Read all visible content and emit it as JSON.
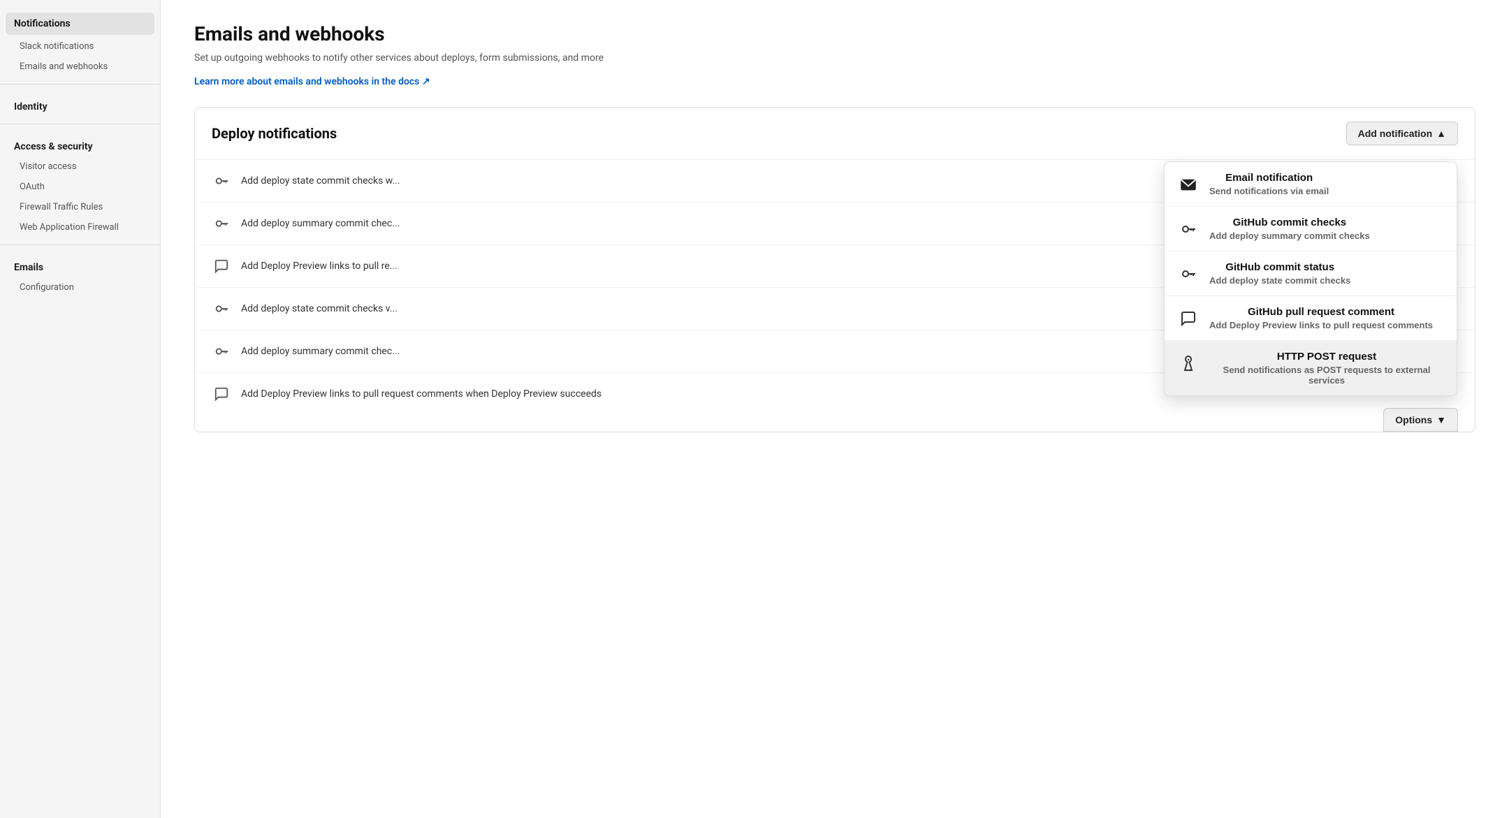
{
  "sidebar": {
    "sections": [
      {
        "label": "Notifications",
        "active": true,
        "items": [
          {
            "label": "Slack notifications",
            "child": true
          },
          {
            "label": "Emails and webhooks",
            "child": true
          }
        ]
      },
      {
        "label": "Identity",
        "active": false,
        "items": []
      },
      {
        "label": "Access & security",
        "active": false,
        "items": [
          {
            "label": "Visitor access",
            "child": true
          },
          {
            "label": "OAuth",
            "child": true
          },
          {
            "label": "Firewall Traffic Rules",
            "child": true
          },
          {
            "label": "Web Application Firewall",
            "child": true
          }
        ]
      },
      {
        "label": "Emails",
        "active": false,
        "items": [
          {
            "label": "Configuration",
            "child": true
          }
        ]
      }
    ]
  },
  "main": {
    "page_title": "Emails and webhooks",
    "page_subtitle": "Set up outgoing webhooks to notify other services about deploys, form submissions, and more",
    "docs_link_text": "Learn more about emails and webhooks in the docs ↗",
    "section_title": "Deploy notifications",
    "add_button_label": "Add notification",
    "add_button_chevron": "▲",
    "notification_items": [
      {
        "icon": "key",
        "text": "Add deploy state commit checks w..."
      },
      {
        "icon": "key",
        "text": "Add deploy summary commit chec..."
      },
      {
        "icon": "chat",
        "text": "Add Deploy Preview links to pull re..."
      },
      {
        "icon": "key",
        "text": "Add deploy state commit checks v..."
      },
      {
        "icon": "key",
        "text": "Add deploy summary commit chec..."
      },
      {
        "icon": "chat",
        "text": "Add Deploy Preview links to pull request comments when Deploy Preview succeeds"
      }
    ],
    "dropdown": {
      "items": [
        {
          "icon": "envelope",
          "title": "Email notification",
          "desc": "Send notifications via email",
          "highlighted": false
        },
        {
          "icon": "key",
          "title": "GitHub commit checks",
          "desc": "Add deploy summary commit checks",
          "highlighted": false
        },
        {
          "icon": "key",
          "title": "GitHub commit status",
          "desc": "Add deploy state commit checks",
          "highlighted": false
        },
        {
          "icon": "chat",
          "title": "GitHub pull request comment",
          "desc": "Add Deploy Preview links to pull request comments",
          "highlighted": false
        },
        {
          "icon": "hook",
          "title": "HTTP POST request",
          "desc": "Send notifications as POST requests to external services",
          "highlighted": true
        }
      ]
    },
    "options_button_label": "Options",
    "options_chevron": "▼"
  }
}
